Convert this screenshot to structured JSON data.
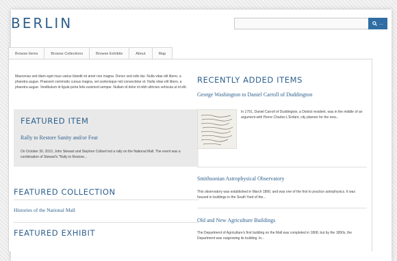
{
  "header": {
    "site_title": "BERLIN",
    "search": {
      "placeholder": "",
      "button_label": "..."
    }
  },
  "nav": {
    "tabs": [
      "Browse Items",
      "Browse Collections",
      "Browse Exhibits",
      "About",
      "Map"
    ]
  },
  "intro_text": "Maecenas sed diam eget risus varius blandit sit amet non magna. Donec sed odio dui. Nulla vitae elit libero, a pharetra augue. Praesent commodo cursus magna, vel scelerisque nisl consectetur et. Nulla vitae elit libero, a pharetra augue. Vestibulum id ligula porta felis euismod semper. Nullam id dolor id nibh ultricies vehicula ut id elit.",
  "featured_item": {
    "heading": "FEATURED ITEM",
    "title": "Rally to Restore Sanity and/or Fear",
    "text": "On October 30, 2010, John Stewart and Stephen Colbert led a rally on the National Mall. The event was a combination of Stewart's \"Rally to Restore..."
  },
  "featured_collection": {
    "heading": "FEATURED COLLECTION",
    "title": "Histories of the National Mall"
  },
  "featured_exhibit": {
    "heading": "FEATURED EXHIBIT"
  },
  "recent": {
    "heading": "RECENTLY ADDED ITEMS",
    "items": [
      {
        "title": "George Washington to Daniel Carroll of Duddington",
        "text": "In 1791, Daniel Carroll of Duddington, a District resident, was in the middle of an argument with Pierre Charles L'Enfant, city planner for the new..."
      },
      {
        "title": "Smithsonian Astrophysical Observatory",
        "text": "This observatory was established in March 1890, and was one of the first to practice astrophysics. It was housed in buildings in the South Yard of the..."
      },
      {
        "title": "Old and New Agriculture Buildings",
        "text": "The Department of Agriculture's first building on the Mall was completed in 1868, but by the 1890s, the Department was outgrowing its building. In..."
      }
    ]
  },
  "colors": {
    "accent": "#2d5f8c",
    "button": "#2f6da3",
    "feature_bg": "#e9e9e9"
  }
}
